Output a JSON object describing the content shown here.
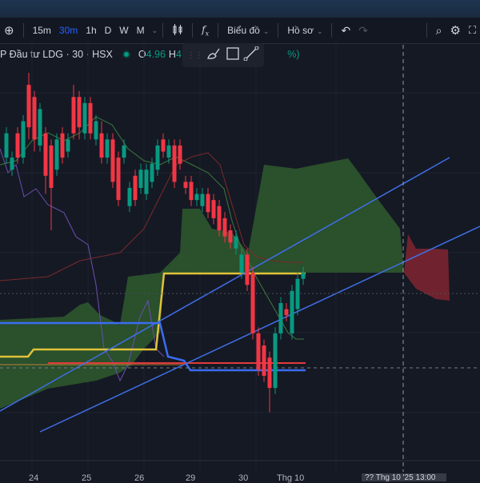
{
  "toolbar": {
    "intervals": [
      "15m",
      "30m",
      "1h",
      "D",
      "W",
      "M"
    ],
    "active_interval": "30m",
    "chart_menu": "Biểu đồ",
    "profile_menu": "Hồ sơ"
  },
  "legend": {
    "symbol": "P Đầu tư LDG · 30 · HSX",
    "open_label": "O",
    "open": "4.96",
    "high_label": "H",
    "high": "4.98",
    "change_tail": "%)"
  },
  "xaxis": {
    "labels": [
      "24",
      "25",
      "26",
      "29",
      "30",
      "Thg 10"
    ],
    "cursor_label": "?? Thg 10 '25  13:00"
  },
  "colors": {
    "up": "#089981",
    "down": "#f23645",
    "accent": "#2962ff"
  },
  "chart_data": {
    "type": "candlestick",
    "interval": "30",
    "price_range": [
      4.6,
      5.24
    ],
    "candles_ochl": [
      [
        5.05,
        5.09,
        5.1,
        5.04
      ],
      [
        5.03,
        5.05,
        5.06,
        5.02
      ],
      [
        5.09,
        5.05,
        5.1,
        5.04
      ],
      [
        5.05,
        5.11,
        5.12,
        5.04
      ],
      [
        5.17,
        5.1,
        5.19,
        5.08
      ],
      [
        5.15,
        5.08,
        5.16,
        5.06
      ],
      [
        5.07,
        5.13,
        5.14,
        5.06
      ],
      [
        5.09,
        5.02,
        5.1,
        4.99
      ],
      [
        5.07,
        5.0,
        5.08,
        4.93
      ],
      [
        5.03,
        5.08,
        5.09,
        5.02
      ],
      [
        5.09,
        5.05,
        5.1,
        5.04
      ],
      [
        5.06,
        5.08,
        5.09,
        5.05
      ],
      [
        5.15,
        5.09,
        5.17,
        5.08
      ],
      [
        5.15,
        5.1,
        5.16,
        5.08
      ],
      [
        5.09,
        5.14,
        5.15,
        5.08
      ],
      [
        5.14,
        5.09,
        5.15,
        5.08
      ],
      [
        5.08,
        5.11,
        5.12,
        5.07
      ],
      [
        5.09,
        5.05,
        5.11,
        5.04
      ],
      [
        5.05,
        5.08,
        5.09,
        5.04
      ],
      [
        5.08,
        5.01,
        5.09,
        5.0
      ],
      [
        5.05,
        4.98,
        5.06,
        4.97
      ],
      [
        5.05,
        5.07,
        5.08,
        5.04
      ],
      [
        4.97,
        5.0,
        5.01,
        4.96
      ],
      [
        5.02,
        4.98,
        5.03,
        4.97
      ],
      [
        5.0,
        5.03,
        5.04,
        4.99
      ],
      [
        4.99,
        5.03,
        5.04,
        4.98
      ],
      [
        5.01,
        5.04,
        5.05,
        5.0
      ],
      [
        5.03,
        5.07,
        5.08,
        5.02
      ],
      [
        5.08,
        5.06,
        5.09,
        5.05
      ],
      [
        5.05,
        5.07,
        5.08,
        5.04
      ],
      [
        5.07,
        5.01,
        5.08,
        5.0
      ],
      [
        5.07,
        5.04,
        5.08,
        5.03
      ],
      [
        5.01,
        5.0,
        5.02,
        4.99
      ],
      [
        5.01,
        4.98,
        5.02,
        4.97
      ],
      [
        4.98,
        4.99,
        5.0,
        4.97
      ],
      [
        4.97,
        4.99,
        5.0,
        4.96
      ],
      [
        4.99,
        4.96,
        5.0,
        4.95
      ],
      [
        4.98,
        4.95,
        4.99,
        4.94
      ],
      [
        4.97,
        4.93,
        4.98,
        4.92
      ],
      [
        4.95,
        4.92,
        4.96,
        4.91
      ],
      [
        4.93,
        4.91,
        4.94,
        4.9
      ],
      [
        4.9,
        4.92,
        4.93,
        4.89
      ],
      [
        4.86,
        4.89,
        4.9,
        4.85
      ],
      [
        4.89,
        4.84,
        4.9,
        4.83
      ],
      [
        4.86,
        4.76,
        4.87,
        4.75
      ],
      [
        4.76,
        4.7,
        4.77,
        4.69
      ],
      [
        4.74,
        4.69,
        4.75,
        4.68
      ],
      [
        4.72,
        4.67,
        4.73,
        4.63
      ],
      [
        4.67,
        4.76,
        4.77,
        4.66
      ],
      [
        4.76,
        4.81,
        4.82,
        4.75
      ],
      [
        4.8,
        4.79,
        4.81,
        4.78
      ],
      [
        4.76,
        4.83,
        4.84,
        4.75
      ],
      [
        4.8,
        4.85,
        4.86,
        4.79
      ],
      [
        4.85,
        4.86,
        4.87,
        4.84
      ]
    ]
  }
}
